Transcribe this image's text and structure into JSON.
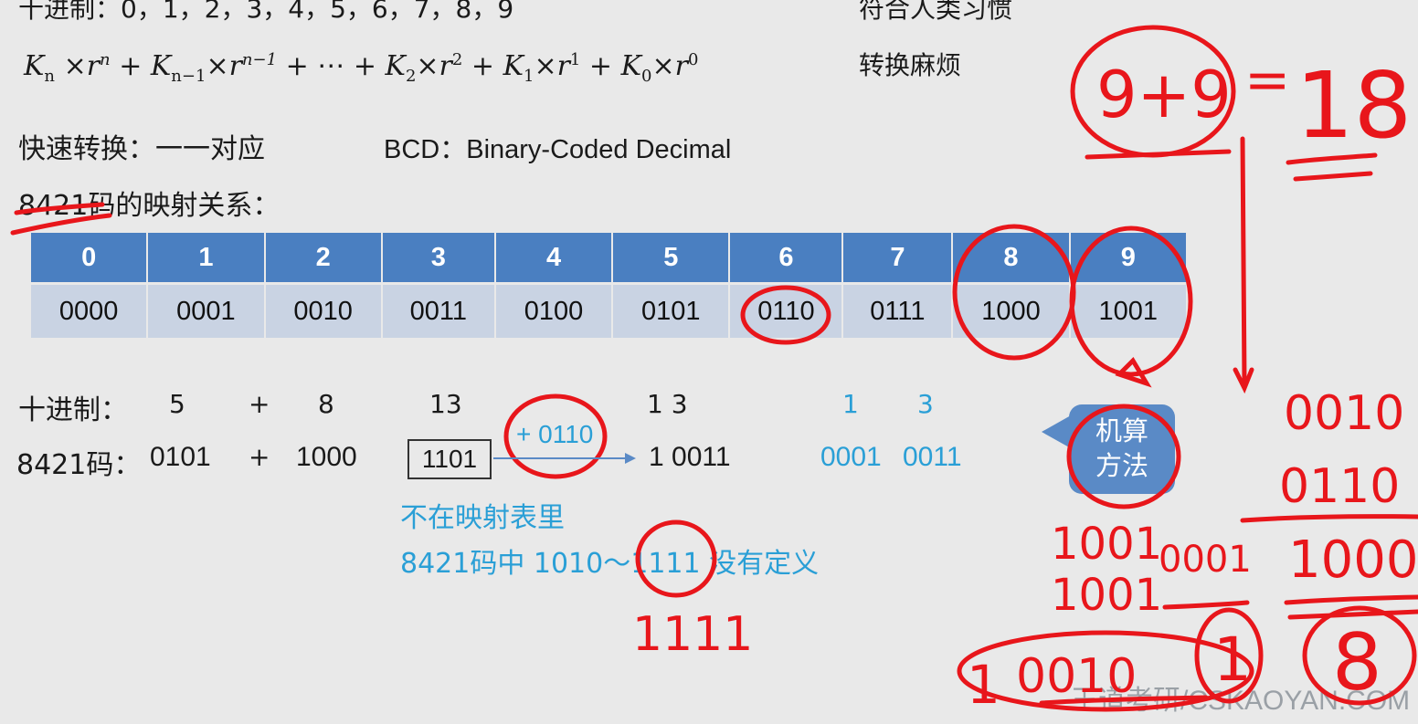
{
  "header": {
    "decimal_line": "十进制：0，1，2，3，4，5，6，7，8，9",
    "human_habit": "符合人类习惯",
    "conversion_trouble": "转换麻烦",
    "fast_convert": "快速转换：一一对应",
    "bcd_label": "BCD：Binary-Coded Decimal",
    "mapping_title": "8421码的映射关系："
  },
  "formula": {
    "K": "K",
    "r": "r",
    "n": "n",
    "n_minus_1": "n−1",
    "sub_2": "2",
    "sub_1": "1",
    "sub_0": "0",
    "exp_n": "n",
    "exp_n_minus_1": "n−1",
    "exp_2": "2",
    "exp_1": "1",
    "exp_0": "0",
    "times": "×",
    "plus": "+",
    "ellipsis": "+ ⋯ +"
  },
  "mapping_table": {
    "digits": [
      "0",
      "1",
      "2",
      "3",
      "4",
      "5",
      "6",
      "7",
      "8",
      "9"
    ],
    "codes": [
      "0000",
      "0001",
      "0010",
      "0011",
      "0100",
      "0101",
      "0110",
      "0111",
      "1000",
      "1001"
    ]
  },
  "example": {
    "decimal_label": "十进制：",
    "code_label": "8421码：",
    "a_dec": "5",
    "plus": "+",
    "b_dec": "8",
    "sum_dec": "13",
    "a_code": "0101",
    "b_code": "1000",
    "sum_code": "1101",
    "correction": "+ 0110",
    "corrected_digits": "1   3",
    "corrected_code": "1 0011",
    "bcd_digits_1": "1",
    "bcd_digits_3": "3",
    "bcd_code_1": "0001",
    "bcd_code_2": "0011",
    "note_1": "不在映射表里",
    "note_2": "8421码中 1010～1111 没有定义"
  },
  "bubble": {
    "line1": "机算",
    "line2": "方法"
  },
  "handwriting": {
    "sum_expr": "9+9",
    "equals": "=",
    "result": "18",
    "col_a": "1001",
    "col_b": "1001",
    "partial": "0001",
    "carry": "1",
    "low": "0010",
    "one": "1",
    "right_1": "0010",
    "right_2": "0110",
    "right_sum": "1000",
    "right_digit_1": "1",
    "right_digit_8": "8",
    "under_1111": "1111"
  },
  "watermark": "王道考研/CSKAOYAN.COM",
  "colors": {
    "table_header": "#4a7fc1",
    "table_row": "#c9d3e3",
    "annotation_blue": "#2a9fd6",
    "ink_red": "#e8161b",
    "bubble": "#5a8ac6"
  }
}
